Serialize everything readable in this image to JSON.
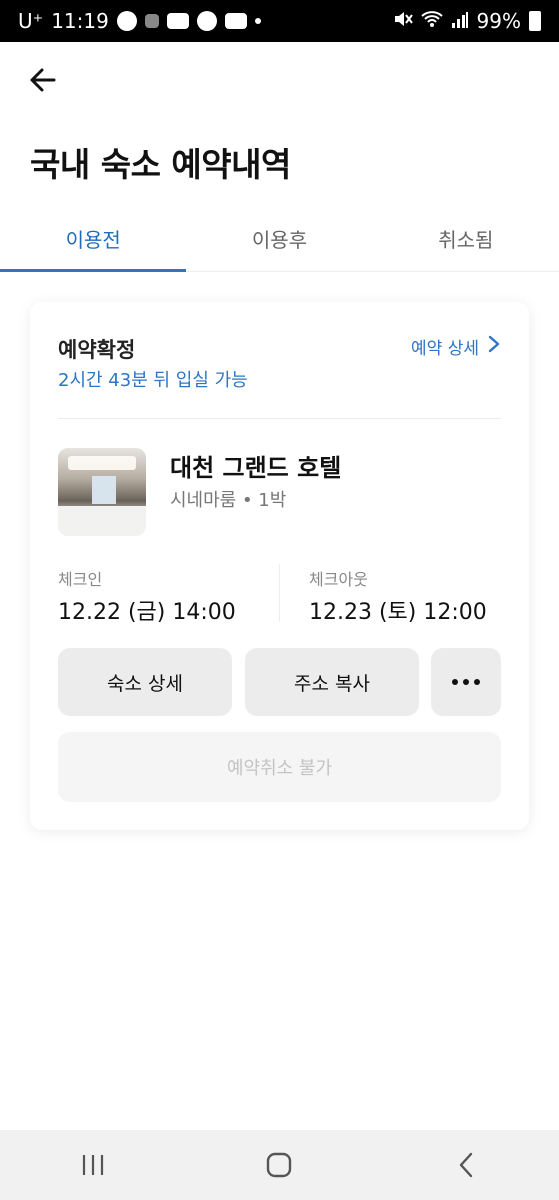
{
  "status_bar": {
    "carrier": "U⁺",
    "time": "11:19",
    "battery": "99%"
  },
  "header": {
    "title": "국내 숙소 예약내역"
  },
  "tabs": [
    {
      "label": "이용전",
      "active": true
    },
    {
      "label": "이용후",
      "active": false
    },
    {
      "label": "취소됨",
      "active": false
    }
  ],
  "reservation": {
    "status": "예약확정",
    "status_sub": "2시간 43분 뒤 입실 가능",
    "detail_link": "예약 상세",
    "hotel_name": "대천 그랜드 호텔",
    "room_info": "시네마룸 • 1박",
    "checkin_label": "체크인",
    "checkin_value": "12.22 (금) 14:00",
    "checkout_label": "체크아웃",
    "checkout_value": "12.23 (토) 12:00",
    "buttons": {
      "stay_detail": "숙소 상세",
      "copy_address": "주소 복사"
    },
    "cancel_label": "예약취소 불가"
  },
  "colors": {
    "accent": "#2c76c5",
    "disabled_text": "#c4c4c4"
  }
}
